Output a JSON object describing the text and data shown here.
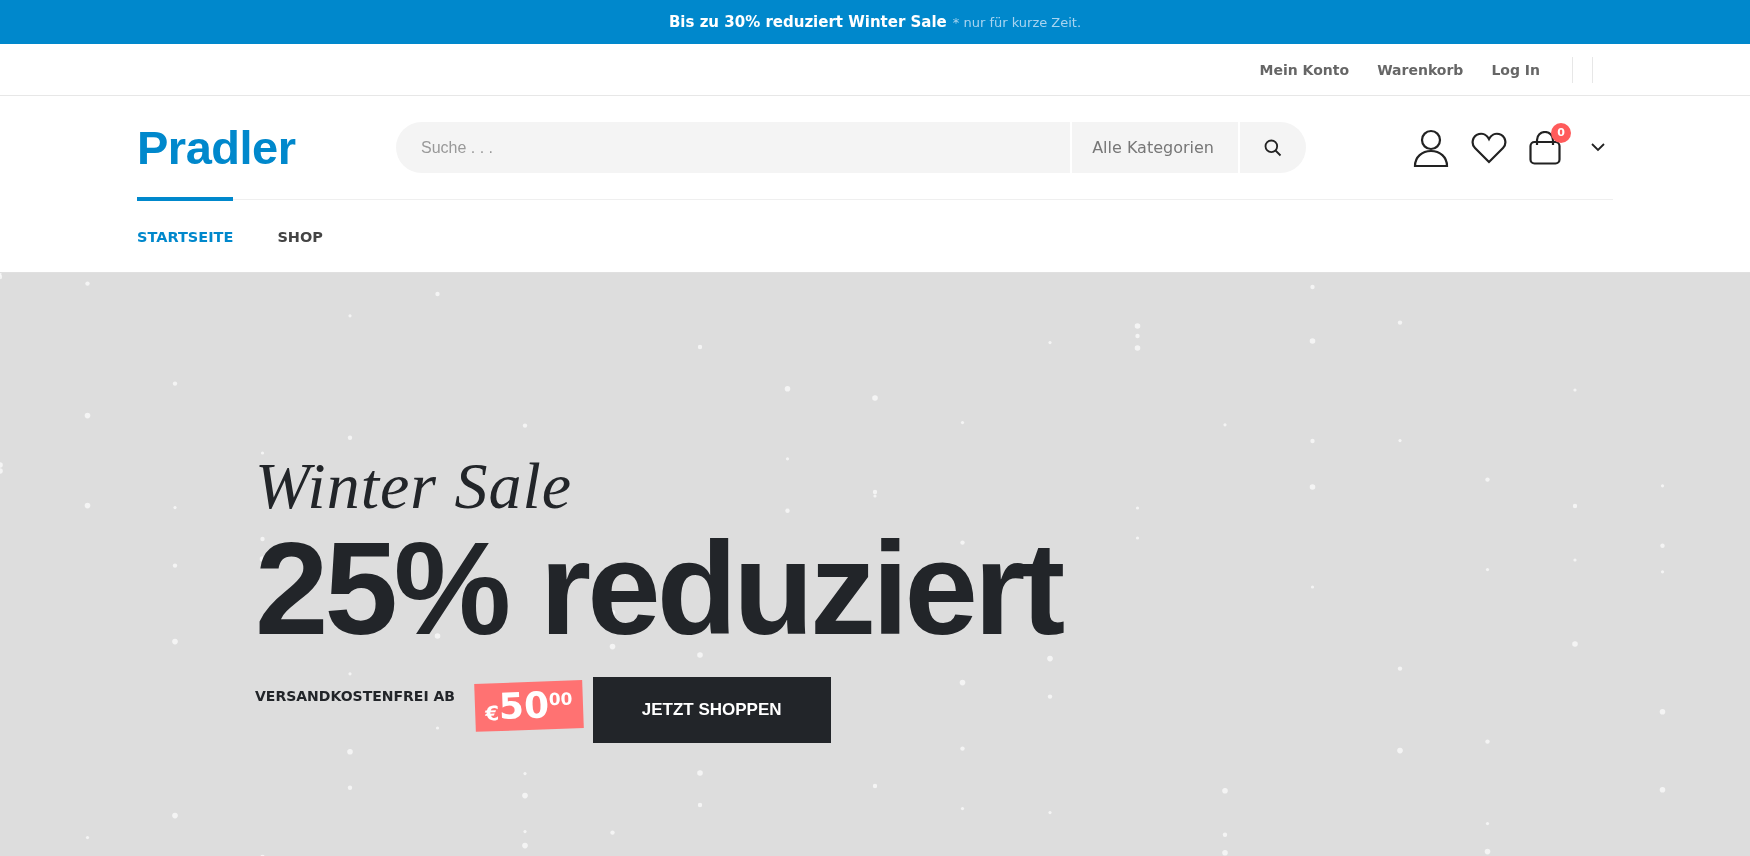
{
  "announcement": {
    "text": "Bis zu **30% reduziert** Winter Sale",
    "note": "* nur für kurze Zeit."
  },
  "top_links": [
    "Mein Konto",
    "Warenkorb",
    "Log In"
  ],
  "logo": "Pradler",
  "search": {
    "placeholder": "Suche . . .",
    "category": "Alle Kategorien"
  },
  "cart": {
    "count": "0"
  },
  "nav": [
    {
      "label": "STARTSEITE",
      "selected": true
    },
    {
      "label": "SHOP",
      "selected": false
    }
  ],
  "hero": {
    "script_title": "Winter Sale",
    "headline": "25% reduziert",
    "shipping_label": "VERSANDKOSTENFREI AB",
    "price": {
      "currency": "€",
      "amount": "50",
      "cents": "00"
    },
    "button": "JETZT SHOPPEN"
  }
}
